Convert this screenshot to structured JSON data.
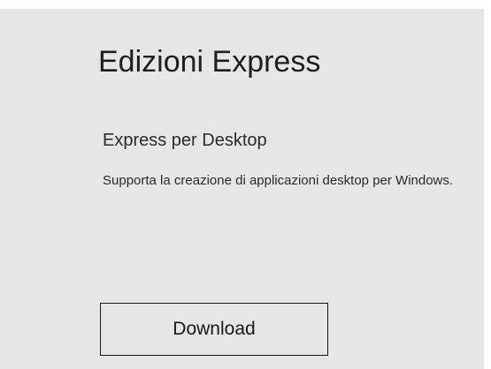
{
  "section": {
    "title": "Edizioni Express"
  },
  "product": {
    "name": "Express per Desktop",
    "description": "Supporta la creazione di applicazioni desktop per Windows."
  },
  "actions": {
    "download_label": "Download"
  }
}
